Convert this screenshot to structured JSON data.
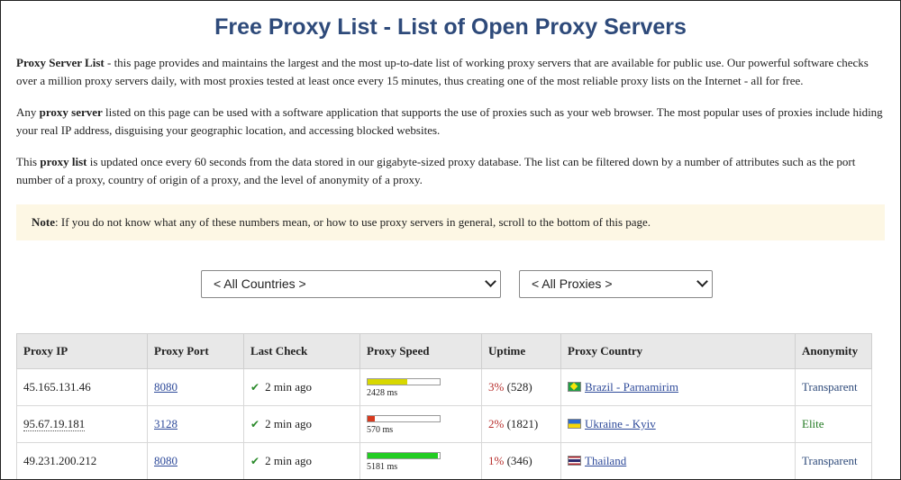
{
  "title": "Free Proxy List - List of Open Proxy Servers",
  "paragraphs": {
    "p1_bold": "Proxy Server List",
    "p1_text": " - this page provides and maintains the largest and the most up-to-date list of working proxy servers that are available for public use. Our powerful software checks over a million proxy servers daily, with most proxies tested at least once every 15 minutes, thus creating one of the most reliable proxy lists on the Internet - all for free.",
    "p2_pre": "Any ",
    "p2_bold": "proxy server",
    "p2_text": " listed on this page can be used with a software application that supports the use of proxies such as your web browser. The most popular uses of proxies include hiding your real IP address, disguising your geographic location, and accessing blocked websites.",
    "p3_pre": "This ",
    "p3_bold": "proxy list",
    "p3_text": " is updated once every 60 seconds from the data stored in our gigabyte-sized proxy database. The list can be filtered down by a number of attributes such as the port number of a proxy, country of origin of a proxy, and the level of anonymity of a proxy."
  },
  "note": {
    "label": "Note",
    "text": ": If you do not know what any of these numbers mean, or how to use proxy servers in general, scroll to the bottom of this page."
  },
  "filters": {
    "country": "< All Countries >",
    "proxy": "< All Proxies >"
  },
  "table": {
    "headers": [
      "Proxy IP",
      "Proxy Port",
      "Last Check",
      "Proxy Speed",
      "Uptime",
      "Proxy Country",
      "Anonymity"
    ],
    "rows": [
      {
        "ip": "45.165.131.46",
        "port": "8080",
        "last_check": "2 min ago",
        "speed_ms": "2428 ms",
        "speed_fraction": 0.55,
        "speed_color": "#d8d800",
        "uptime_pct": "3%",
        "uptime_count": "(528)",
        "flag": "flag-br",
        "country": "Brazil - Parnamirim",
        "anonymity": "Transparent",
        "anon_class": "anon-transparent"
      },
      {
        "ip": "95.67.19.181",
        "port": "3128",
        "last_check": "2 min ago",
        "speed_ms": "570 ms",
        "speed_fraction": 0.1,
        "speed_color": "#d83a1e",
        "uptime_pct": "2%",
        "uptime_count": "(1821)",
        "flag": "flag-ua",
        "country": "Ukraine - Kyiv",
        "anonymity": "Elite",
        "anon_class": "anon-elite"
      },
      {
        "ip": "49.231.200.212",
        "port": "8080",
        "last_check": "2 min ago",
        "speed_ms": "5181 ms",
        "speed_fraction": 0.98,
        "speed_color": "#22cc22",
        "uptime_pct": "1%",
        "uptime_count": "(346)",
        "flag": "flag-th",
        "country": "Thailand",
        "anonymity": "Transparent",
        "anon_class": "anon-transparent"
      }
    ]
  }
}
